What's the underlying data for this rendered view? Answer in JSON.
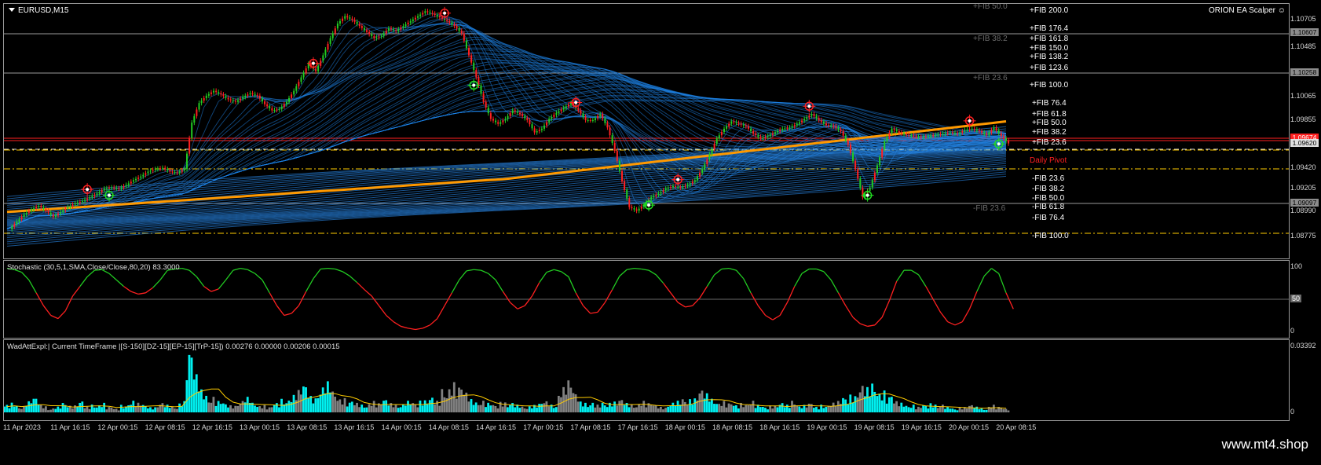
{
  "chart": {
    "symbol_label": "EURUSD,M15",
    "ea_label": "ORION EA Scalper",
    "ea_icon": "smiley-icon"
  },
  "price_axis": {
    "ticks": [
      "1.10705",
      "1.10485",
      "1.10065",
      "1.09855",
      "1.09420",
      "1.09205",
      "1.08990",
      "1.08775"
    ],
    "tags": [
      {
        "text": "1.10607",
        "color": "#8c8c8c"
      },
      {
        "text": "1.10258",
        "color": "#8c8c8c"
      },
      {
        "text": "1.09674",
        "color": "#ff2020"
      },
      {
        "text": "1.09620",
        "color": "#e0e0e0"
      },
      {
        "text": "1.09097",
        "color": "#8c8c8c"
      }
    ]
  },
  "fib_labels": {
    "upper": [
      "+FIB 200.0",
      "+FIB 176.4",
      "+FIB 161.8",
      "+FIB 150.0",
      "+FIB 138.2",
      "+FIB 123.6",
      "+FIB 100.0"
    ],
    "upper_b": [
      "+FIB 76.4",
      "+FIB 61.8",
      "+FIB 50.0",
      "+FIB 38.2",
      "+FIB 23.6"
    ],
    "lower": [
      "-FIB 23.6",
      "-FIB 38.2",
      "-FIB 50.0",
      "-FIB 61.8",
      "-FIB 76.4",
      "-FIB 100.0"
    ],
    "dim": [
      "+FIB 50.0",
      "+FIB 38.2",
      "+FIB 23.6",
      "-FIB 23.6"
    ],
    "pivot": "Daily Pivot"
  },
  "stochastic": {
    "title": "Stochastic (30,5,1,SMA,Close/Close,80,20) 83.3000",
    "levels": [
      "100",
      "50",
      "0"
    ]
  },
  "wad": {
    "title": "WadAttExpl:| Current TimeFrame |[S-150][DZ-15][EP-15][TrP-15]) 0.00276 0.00000 0.00206 0.00015",
    "levels": [
      "0.03392",
      "0"
    ]
  },
  "time_axis": [
    "11 Apr 2023",
    "11 Apr 16:15",
    "12 Apr 00:15",
    "12 Apr 08:15",
    "12 Apr 16:15",
    "13 Apr 00:15",
    "13 Apr 08:15",
    "13 Apr 16:15",
    "14 Apr 00:15",
    "14 Apr 08:15",
    "14 Apr 16:15",
    "17 Apr 00:15",
    "17 Apr 08:15",
    "17 Apr 16:15",
    "18 Apr 00:15",
    "18 Apr 08:15",
    "18 Apr 16:15",
    "19 Apr 00:15",
    "19 Apr 08:15",
    "19 Apr 16:15",
    "20 Apr 00:15",
    "20 Apr 08:15"
  ],
  "watermark": "www.mt4.shop",
  "colors": {
    "bull": "#22cc22",
    "bear": "#ff2020",
    "ribbon": "#1e7fe0",
    "ma": "#ff9900",
    "pivot": "#ffcc00",
    "hist_cyan": "#00f0f0",
    "hist_gray": "#808080"
  },
  "price_series": [
    1.0896,
    1.0902,
    1.0908,
    1.0912,
    1.0915,
    1.0911,
    1.0906,
    1.091,
    1.0914,
    1.0917,
    1.0919,
    1.0922,
    1.0925,
    1.0929,
    1.093,
    1.0929,
    1.0932,
    1.0936,
    1.0939,
    1.0943,
    1.0945,
    1.0946,
    1.0943,
    1.0942,
    1.0945,
    1.0983,
    1.0999,
    1.1005,
    1.1009,
    1.1006,
    1.1002,
    1.1,
    1.1004,
    1.1007,
    1.1005,
    1.0998,
    1.0993,
    1.0994,
    1.1,
    1.1009,
    1.102,
    1.1031,
    1.1025,
    1.1038,
    1.1052,
    1.1064,
    1.107,
    1.1067,
    1.1062,
    1.1057,
    1.1052,
    1.1054,
    1.106,
    1.1058,
    1.1062,
    1.1066,
    1.107,
    1.1074,
    1.1072,
    1.1069,
    1.1066,
    1.1062,
    1.1056,
    1.1038,
    1.102,
    1.1,
    1.0986,
    1.0982,
    1.0986,
    1.0993,
    1.099,
    1.0985,
    1.0975,
    1.0978,
    1.0986,
    1.0991,
    1.0995,
    1.0999,
    1.0993,
    1.0985,
    1.0985,
    1.099,
    1.0979,
    1.096,
    1.0935,
    1.0914,
    1.0911,
    1.0916,
    1.0922,
    1.0925,
    1.0929,
    1.0931,
    1.093,
    1.0932,
    1.0936,
    1.0945,
    1.0957,
    1.097,
    1.0978,
    1.0984,
    1.0982,
    1.098,
    1.0974,
    1.097,
    1.0972,
    1.0975,
    1.0978,
    1.0979,
    1.0982,
    1.0986,
    1.099,
    1.0985,
    1.0981,
    1.098,
    1.0976,
    1.0965,
    1.0945,
    1.0922,
    1.093,
    1.0948,
    1.0968,
    1.0978,
    1.0975,
    1.0973,
    1.0972,
    1.0971,
    1.0972,
    1.0973,
    1.0974,
    1.0975,
    1.0974,
    1.0977,
    1.0978,
    1.0976,
    1.0973,
    1.0979,
    1.0972,
    1.0966
  ],
  "stoch_series": [
    98,
    96,
    92,
    80,
    60,
    40,
    25,
    20,
    32,
    55,
    70,
    85,
    95,
    96,
    90,
    80,
    70,
    62,
    58,
    60,
    68,
    80,
    95,
    97,
    98,
    95,
    85,
    70,
    62,
    66,
    80,
    95,
    98,
    96,
    90,
    80,
    60,
    40,
    25,
    28,
    40,
    62,
    82,
    97,
    98,
    97,
    93,
    86,
    76,
    65,
    55,
    40,
    25,
    15,
    8,
    5,
    3,
    5,
    10,
    20,
    40,
    60,
    80,
    94,
    96,
    95,
    90,
    80,
    62,
    45,
    35,
    40,
    55,
    76,
    92,
    96,
    93,
    85,
    60,
    40,
    28,
    30,
    45,
    65,
    86,
    96,
    98,
    97,
    95,
    88,
    75,
    60,
    45,
    38,
    40,
    52,
    70,
    88,
    97,
    98,
    95,
    82,
    60,
    40,
    25,
    18,
    25,
    45,
    70,
    90,
    97,
    97,
    93,
    80,
    60,
    40,
    22,
    12,
    8,
    10,
    22,
    48,
    78,
    95,
    95,
    88,
    70,
    50,
    30,
    15,
    10,
    15,
    35,
    62,
    86,
    98,
    90,
    60,
    35
  ],
  "wad_series": [
    0.004,
    0.005,
    0.003,
    0.006,
    0.008,
    0.004,
    0.002,
    0.003,
    0.005,
    0.004,
    0.006,
    0.003,
    0.004,
    0.005,
    0.003,
    0.002,
    0.004,
    0.006,
    0.005,
    0.004,
    0.003,
    0.005,
    0.004,
    0.003,
    0.006,
    0.033,
    0.021,
    0.012,
    0.008,
    0.006,
    0.005,
    0.004,
    0.006,
    0.008,
    0.005,
    0.004,
    0.003,
    0.005,
    0.007,
    0.009,
    0.012,
    0.015,
    0.009,
    0.013,
    0.016,
    0.011,
    0.008,
    0.006,
    0.005,
    0.004,
    0.006,
    0.005,
    0.007,
    0.005,
    0.004,
    0.006,
    0.005,
    0.007,
    0.008,
    0.006,
    0.012,
    0.016,
    0.014,
    0.011,
    0.007,
    0.006,
    0.005,
    0.004,
    0.006,
    0.005,
    0.004,
    0.003,
    0.004,
    0.005,
    0.006,
    0.004,
    0.013,
    0.017,
    0.011,
    0.006,
    0.005,
    0.004,
    0.005,
    0.006,
    0.007,
    0.005,
    0.004,
    0.006,
    0.005,
    0.004,
    0.003,
    0.005,
    0.006,
    0.007,
    0.008,
    0.012,
    0.01,
    0.007,
    0.006,
    0.005,
    0.004,
    0.005,
    0.006,
    0.004,
    0.003,
    0.004,
    0.005,
    0.004,
    0.006,
    0.004,
    0.005,
    0.003,
    0.004,
    0.005,
    0.006,
    0.008,
    0.01,
    0.014,
    0.013,
    0.015,
    0.012,
    0.009,
    0.006,
    0.005,
    0.004,
    0.003,
    0.004,
    0.005,
    0.004,
    0.003,
    0.002,
    0.003,
    0.004,
    0.003,
    0.002,
    0.004,
    0.003,
    0.002
  ],
  "wad_flags": [
    1,
    1,
    0,
    1,
    1,
    0,
    0,
    1,
    1,
    0,
    1,
    0,
    1,
    1,
    0,
    0,
    1,
    1,
    0,
    1,
    1,
    0,
    1,
    0,
    1,
    1,
    1,
    1,
    0,
    1,
    1,
    0,
    0,
    1,
    1,
    0,
    0,
    1,
    1,
    1,
    0,
    1,
    1,
    1,
    1,
    0,
    0,
    1,
    0,
    1,
    0,
    0,
    1,
    0,
    1,
    1,
    0,
    1,
    1,
    0,
    0,
    0,
    0,
    0,
    1,
    0,
    1,
    0,
    0,
    1,
    1,
    0,
    1,
    1,
    0,
    1,
    0,
    0,
    0,
    1,
    1,
    0,
    1,
    1,
    0,
    1,
    0,
    0,
    0,
    0,
    0,
    1,
    1,
    0,
    1,
    0,
    1,
    1,
    0,
    0,
    1,
    0,
    0,
    1,
    1,
    0,
    1,
    1,
    0,
    1,
    0,
    1,
    1,
    0,
    0,
    1,
    1,
    0,
    1,
    1,
    1,
    1,
    0,
    1,
    1,
    0,
    1,
    1,
    0,
    1,
    1,
    0,
    0,
    1,
    1,
    0
  ]
}
